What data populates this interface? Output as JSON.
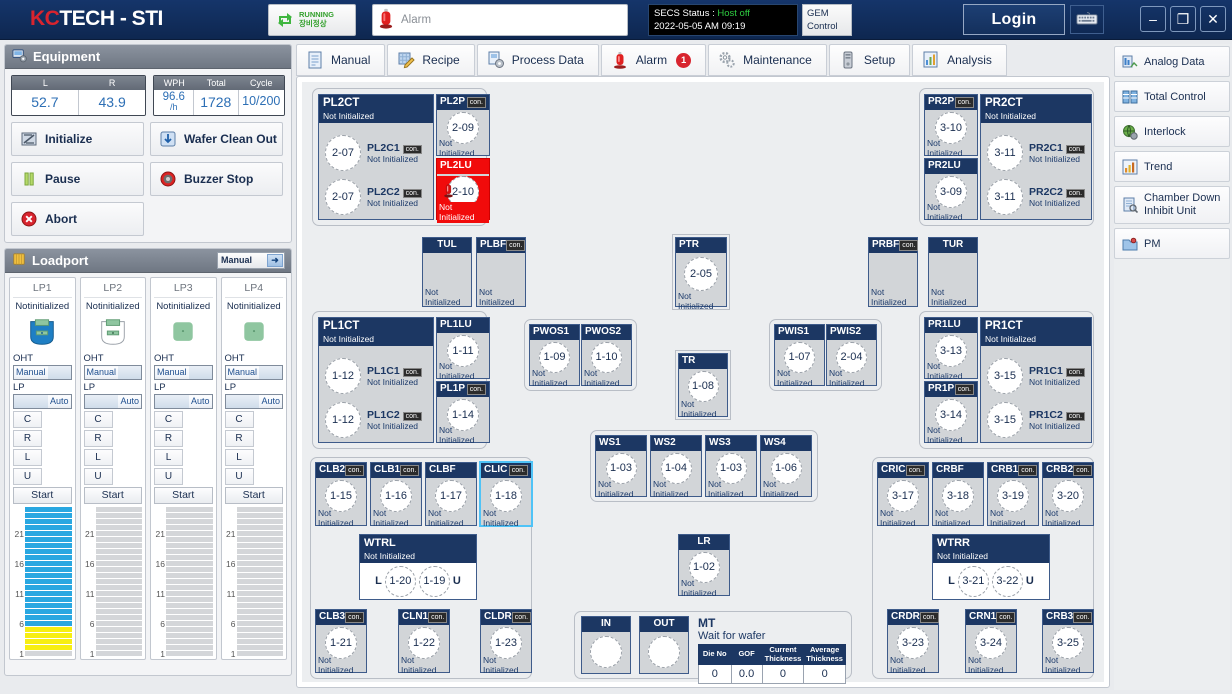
{
  "header": {
    "logo_kc": "KC",
    "logo_tech": "TECH",
    "logo_sti": "- STI",
    "run_line1": "RUNNING",
    "run_line2": "장비정상",
    "alarm_placeholder": "Alarm",
    "secs_label": "SECS Status : ",
    "secs_value": "Host off",
    "secs_time": "2022-05-05 AM 09:19",
    "gem_line1": "GEM",
    "gem_line2": "Control",
    "login_label": "Login",
    "minimize": "–",
    "maximize": "❐",
    "close": "✕"
  },
  "equipment": {
    "title": "Equipment",
    "lr": {
      "headers": [
        "L",
        "R"
      ],
      "values": [
        "52.7",
        "43.9"
      ]
    },
    "wph": {
      "headers": [
        "WPH",
        "Total",
        "Cycle"
      ],
      "wph_value": "96.6",
      "wph_unit": "/h",
      "total_value": "1728",
      "cycle_value": "10/200"
    },
    "buttons": [
      {
        "label": "Initialize",
        "icon": "initialize-icon"
      },
      {
        "label": "Wafer Clean Out",
        "icon": "wafer-clean-out-icon"
      },
      {
        "label": "Pause",
        "icon": "pause-icon"
      },
      {
        "label": "Buzzer Stop",
        "icon": "buzzer-stop-icon"
      },
      {
        "label": "Abort",
        "icon": "abort-icon"
      }
    ]
  },
  "loadport": {
    "title": "Loadport",
    "mode": "Manual",
    "ports": [
      {
        "name": "LP1",
        "status": "Notinitialized",
        "carrier": "filled-blue",
        "oht_label": "OHT",
        "oht_mode": "Manual",
        "lp_label": "LP",
        "lp_mode": "Auto",
        "keys": [
          "C",
          "R",
          "L",
          "U"
        ],
        "start": "Start",
        "slot_ticks": [
          "1",
          "6",
          "11",
          "16",
          "21"
        ],
        "slots": [
          "empty",
          "yellow",
          "yellow",
          "yellow",
          "yellow",
          "blue",
          "blue",
          "blue",
          "blue",
          "blue",
          "blue",
          "blue",
          "blue",
          "blue",
          "blue",
          "blue",
          "blue",
          "blue",
          "blue",
          "blue",
          "blue",
          "blue",
          "blue",
          "blue",
          "blue"
        ]
      },
      {
        "name": "LP2",
        "status": "Notinitialized",
        "carrier": "empty-outline",
        "oht_label": "OHT",
        "oht_mode": "Manual",
        "lp_label": "LP",
        "lp_mode": "Auto",
        "keys": [
          "C",
          "R",
          "L",
          "U"
        ],
        "start": "Start",
        "slot_ticks": [
          "1",
          "6",
          "11",
          "16",
          "21"
        ],
        "slots": [
          "empty",
          "empty",
          "empty",
          "empty",
          "empty",
          "empty",
          "empty",
          "empty",
          "empty",
          "empty",
          "empty",
          "empty",
          "empty",
          "empty",
          "empty",
          "empty",
          "empty",
          "empty",
          "empty",
          "empty",
          "empty",
          "empty",
          "empty",
          "empty",
          "empty"
        ]
      },
      {
        "name": "LP3",
        "status": "Notinitialized",
        "carrier": "green-square",
        "oht_label": "OHT",
        "oht_mode": "Manual",
        "lp_label": "LP",
        "lp_mode": "Auto",
        "keys": [
          "C",
          "R",
          "L",
          "U"
        ],
        "start": "Start",
        "slot_ticks": [
          "1",
          "6",
          "11",
          "16",
          "21"
        ],
        "slots": [
          "empty",
          "empty",
          "empty",
          "empty",
          "empty",
          "empty",
          "empty",
          "empty",
          "empty",
          "empty",
          "empty",
          "empty",
          "empty",
          "empty",
          "empty",
          "empty",
          "empty",
          "empty",
          "empty",
          "empty",
          "empty",
          "empty",
          "empty",
          "empty",
          "empty"
        ]
      },
      {
        "name": "LP4",
        "status": "Notinitialized",
        "carrier": "green-square",
        "oht_label": "OHT",
        "oht_mode": "Manual",
        "lp_label": "LP",
        "lp_mode": "Auto",
        "keys": [
          "C",
          "R",
          "L",
          "U"
        ],
        "start": "Start",
        "slot_ticks": [
          "1",
          "6",
          "11",
          "16",
          "21"
        ],
        "slots": [
          "empty",
          "empty",
          "empty",
          "empty",
          "empty",
          "empty",
          "empty",
          "empty",
          "empty",
          "empty",
          "empty",
          "empty",
          "empty",
          "empty",
          "empty",
          "empty",
          "empty",
          "empty",
          "empty",
          "empty",
          "empty",
          "empty",
          "empty",
          "empty",
          "empty"
        ]
      }
    ]
  },
  "tabs": [
    {
      "label": "Manual",
      "icon": "document-icon",
      "badge": null
    },
    {
      "label": "Recipe",
      "icon": "recipe-pencil-icon",
      "badge": null
    },
    {
      "label": "Process Data",
      "icon": "process-data-icon",
      "badge": null
    },
    {
      "label": "Alarm",
      "icon": "alarm-lamp-icon",
      "badge": "1"
    },
    {
      "label": "Maintenance",
      "icon": "gears-icon",
      "badge": null
    },
    {
      "label": "Setup",
      "icon": "server-icon",
      "badge": null
    },
    {
      "label": "Analysis",
      "icon": "analysis-chart-icon",
      "badge": null
    }
  ],
  "right_menu": [
    {
      "label": "Analog Data",
      "icon": "analog-data-icon"
    },
    {
      "label": "Total Control",
      "icon": "total-control-icon"
    },
    {
      "label": "Interlock",
      "icon": "interlock-globe-icon"
    },
    {
      "label": "Trend",
      "icon": "trend-icon"
    },
    {
      "label": "Chamber Down",
      "label2": "Inhibit Unit",
      "icon": "chamber-down-icon"
    },
    {
      "label": "PM",
      "icon": "pm-icon"
    }
  ],
  "status_text": "Not Initialized",
  "diagram": {
    "pl2ct": {
      "title": "PL2CT",
      "status": "Not Initialized",
      "rows": [
        {
          "circle": "2-07",
          "name": "PL2C1",
          "con": "con.",
          "status": "Not Initialized"
        },
        {
          "circle": "2-07",
          "name": "PL2C2",
          "con": "con.",
          "status": "Not Initialized"
        }
      ]
    },
    "pl2p": {
      "title": "PL2P",
      "con": "con.",
      "circle": "2-09",
      "status": "Not Initialized"
    },
    "pl2lu": {
      "title": "PL2LU",
      "circle": "2-10",
      "status": "Not Initialized",
      "alarm": true
    },
    "pr2p": {
      "title": "PR2P",
      "con": "con.",
      "circle": "3-10",
      "status": "Not Initialized"
    },
    "pr2lu": {
      "title": "PR2LU",
      "circle": "3-09",
      "status": "Not Initialized"
    },
    "pr2ct": {
      "title": "PR2CT",
      "status": "Not Initialized",
      "rows": [
        {
          "circle": "3-11",
          "name": "PR2C1",
          "con": "con.",
          "status": "Not Initialized"
        },
        {
          "circle": "3-11",
          "name": "PR2C2",
          "con": "con.",
          "status": "Not Initialized"
        }
      ]
    },
    "tul": {
      "title": "TUL",
      "status": "Not Initialized"
    },
    "plbf": {
      "title": "PLBF",
      "con": "con.",
      "status": "Not Initialized"
    },
    "ptr": {
      "title": "PTR",
      "circle": "2-05",
      "status": "Not Initialized"
    },
    "prbf": {
      "title": "PRBF",
      "con": "con.",
      "status": "Not Initialized"
    },
    "tur": {
      "title": "TUR",
      "status": "Not Initialized"
    },
    "pl1ct": {
      "title": "PL1CT",
      "status": "Not Initialized",
      "rows": [
        {
          "circle": "1-12",
          "name": "PL1C1",
          "con": "con.",
          "status": "Not Initialized"
        },
        {
          "circle": "1-12",
          "name": "PL1C2",
          "con": "con.",
          "status": "Not Initialized"
        }
      ]
    },
    "pl1lu": {
      "title": "PL1LU",
      "circle": "1-11",
      "status": "Not Initialized"
    },
    "pl1p": {
      "title": "PL1P",
      "con": "con.",
      "circle": "1-14",
      "status": "Not Initialized"
    },
    "pwos1": {
      "title": "PWOS1",
      "circle": "1-09",
      "status": "Not Initialized"
    },
    "pwos2": {
      "title": "PWOS2",
      "circle": "1-10",
      "status": "Not Initialized"
    },
    "tr": {
      "title": "TR",
      "circle": "1-08",
      "status": "Not Initialized"
    },
    "pwis1": {
      "title": "PWIS1",
      "circle": "1-07",
      "status": "Not Initialized"
    },
    "pwis2": {
      "title": "PWIS2",
      "circle": "2-04",
      "status": "Not Initialized"
    },
    "pr1lu": {
      "title": "PR1LU",
      "circle": "3-13",
      "status": "Not Initialized"
    },
    "pr1p": {
      "title": "PR1P",
      "con": "con.",
      "circle": "3-14",
      "status": "Not Initialized"
    },
    "pr1ct": {
      "title": "PR1CT",
      "status": "Not Initialized",
      "rows": [
        {
          "circle": "3-15",
          "name": "PR1C1",
          "con": "con.",
          "status": "Not Initialized"
        },
        {
          "circle": "3-15",
          "name": "PR1C2",
          "con": "con.",
          "status": "Not Initialized"
        }
      ]
    },
    "clb2": {
      "title": "CLB2",
      "con": "con.",
      "circle": "1-15",
      "status": "Not Initialized"
    },
    "clb1": {
      "title": "CLB1",
      "con": "con.",
      "circle": "1-16",
      "status": "Not Initialized"
    },
    "clbf": {
      "title": "CLBF",
      "circle": "1-17",
      "status": "Not Initialized"
    },
    "clic": {
      "title": "CLIC",
      "con": "con.",
      "circle": "1-18",
      "status": "Not Initialized"
    },
    "wtrl": {
      "title": "WTRL",
      "status": "Not Initialized",
      "left_label": "L",
      "left_circle": "1-20",
      "right_circle": "1-19",
      "right_label": "U"
    },
    "clb3": {
      "title": "CLB3",
      "con": "con.",
      "circle": "1-21",
      "status": "Not Initialized"
    },
    "cln1": {
      "title": "CLN1",
      "con": "con.",
      "circle": "1-22",
      "status": "Not Initialized"
    },
    "cldr": {
      "title": "CLDR",
      "con": "con.",
      "circle": "1-23",
      "status": "Not Initialized"
    },
    "ws": [
      {
        "title": "WS1",
        "circle": "1-03",
        "status": "Not Initialized"
      },
      {
        "title": "WS2",
        "circle": "1-04",
        "status": "Not Initialized"
      },
      {
        "title": "WS3",
        "circle": "1-03",
        "status": "Not Initialized"
      },
      {
        "title": "WS4",
        "circle": "1-06",
        "status": "Not Initialized"
      }
    ],
    "lr": {
      "title": "LR",
      "circle": "1-02",
      "status": "Not Initialized"
    },
    "in": {
      "title": "IN"
    },
    "out": {
      "title": "OUT"
    },
    "mt": {
      "title": "MT",
      "subtitle": "Wait for wafer",
      "headers": [
        "Die No",
        "GOF",
        "Current Thickness",
        "Average Thickness"
      ],
      "values": [
        "0",
        "0.0",
        "0",
        "0"
      ]
    },
    "cric": {
      "title": "CRIC",
      "con": "con.",
      "circle": "3-17",
      "status": "Not Initialized"
    },
    "crbf": {
      "title": "CRBF",
      "circle": "3-18",
      "status": "Not Initialized"
    },
    "crb1": {
      "title": "CRB1",
      "con": "con.",
      "circle": "3-19",
      "status": "Not Initialized"
    },
    "crb2": {
      "title": "CRB2",
      "con": "con.",
      "circle": "3-20",
      "status": "Not Initialized"
    },
    "wtrr": {
      "title": "WTRR",
      "status": "Not Initialized",
      "left_label": "L",
      "left_circle": "3-21",
      "right_circle": "3-22",
      "right_label": "U"
    },
    "crdr": {
      "title": "CRDR",
      "con": "con.",
      "circle": "3-23",
      "status": "Not Initialized"
    },
    "crn1": {
      "title": "CRN1",
      "con": "con.",
      "circle": "3-24",
      "status": "Not Initialized"
    },
    "crb3": {
      "title": "CRB3",
      "con": "con.",
      "circle": "3-25",
      "status": "Not Initialized"
    }
  },
  "colors": {
    "header_navy": "#12305c",
    "unit_navy": "#1c3763",
    "alarm_red": "#f10b0b",
    "accent_blue": "#2d6fb5",
    "wafer_blue": "#29a7e1",
    "wafer_yellow": "#f7ee12",
    "running_green": "#33a02c"
  }
}
